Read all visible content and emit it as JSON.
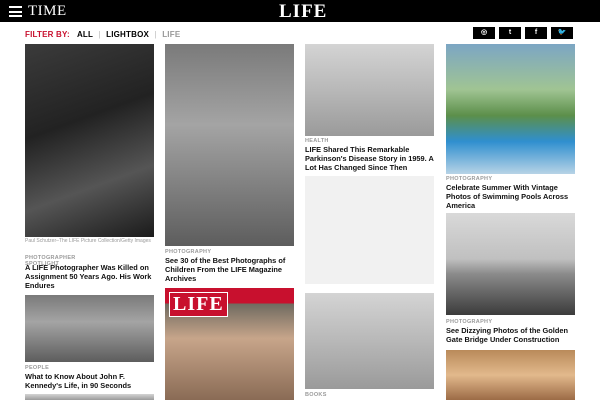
{
  "header": {
    "time_logo": "TIME",
    "life_logo": "LIFE"
  },
  "filter": {
    "label": "FILTER BY:",
    "items": [
      "ALL",
      "LIGHTBOX",
      "LIFE"
    ]
  },
  "social": [
    "instagram-icon",
    "tumblr-icon",
    "facebook-icon",
    "twitter-icon"
  ],
  "social_glyphs": [
    "◎",
    "t",
    "f",
    "🐦"
  ],
  "cards": {
    "c1": {
      "credit": "Paul Schutzer–The LIFE Picture Collection/Getty Images",
      "tag": "PHOTOGRAPHER SPOTLIGHT",
      "title": "A LIFE Photographer Was Killed on Assignment 50 Years Ago. His Work Endures"
    },
    "c2": {
      "tag": "PHOTOGRAPHY",
      "title": "See 30 of the Best Photographs of Children From the LIFE Magazine Archives"
    },
    "c3": {
      "tag": "HEALTH",
      "title": "LIFE Shared This Remarkable Parkinson's Disease Story in 1959. A Lot Has Changed Since Then"
    },
    "c4": {
      "tag": "PHOTOGRAPHY",
      "title": "Celebrate Summer With Vintage Photos of Swimming Pools Across America"
    },
    "c5": {
      "tag": "PEOPLE",
      "title": "What to Know About John F. Kennedy's Life, in 90 Seconds"
    },
    "c6": {
      "badge": "LIFE"
    },
    "c7": {
      "tag": "BOOKS"
    },
    "c8": {
      "tag": "PHOTOGRAPHY",
      "title": "See Dizzying Photos of the Golden Gate Bridge Under Construction"
    }
  },
  "colors": {
    "accent": "#c8102e",
    "topbar": "#000000"
  }
}
